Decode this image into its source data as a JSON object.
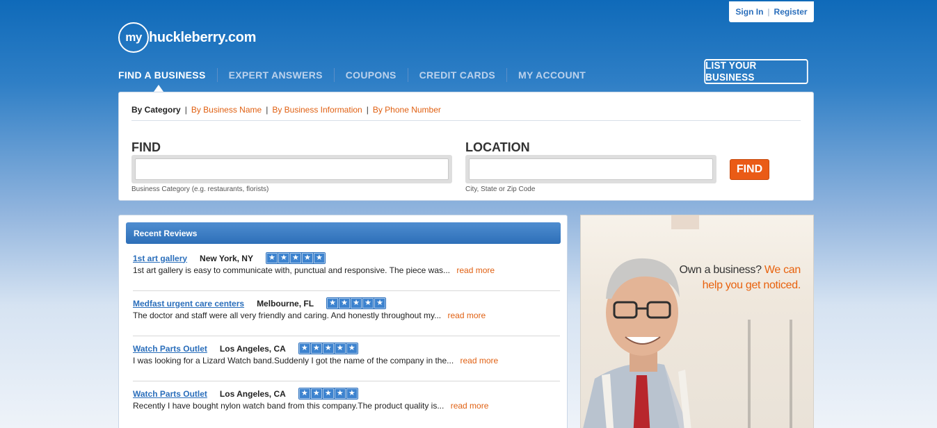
{
  "auth": {
    "signin": "Sign In",
    "separator": "|",
    "register": "Register"
  },
  "logo": {
    "circle": "my",
    "text": "huckleberry.com"
  },
  "nav": {
    "items": [
      "FIND A BUSINESS",
      "EXPERT ANSWERS",
      "COUPONS",
      "CREDIT CARDS",
      "MY ACCOUNT"
    ],
    "active_index": 0
  },
  "list_business": "LIST YOUR BUSINESS",
  "search": {
    "tabs": [
      "By Category",
      "By Business Name",
      "By Business Information",
      "By Phone Number"
    ],
    "tab_separator": "|",
    "find_label": "FIND",
    "find_value": "",
    "find_hint": "Business Category (e.g. restaurants, florists)",
    "location_label": "LOCATION",
    "location_value": "",
    "location_hint": "City, State or Zip Code",
    "button": "FIND"
  },
  "reviews": {
    "title": "Recent Reviews",
    "more_label": "read more",
    "star_glyph": "★",
    "items": [
      {
        "business": "1st art gallery",
        "location": "New York, NY",
        "rating": 5,
        "snippet": "1st art gallery is easy to communicate with, punctual and responsive. The piece was..."
      },
      {
        "business": "Medfast urgent care centers",
        "location": "Melbourne, FL",
        "rating": 5,
        "snippet": "The doctor and staff were all very friendly and caring. And honestly throughout my..."
      },
      {
        "business": "Watch Parts Outlet",
        "location": "Los Angeles, CA",
        "rating": 5,
        "snippet": "I was looking for a Lizard Watch band.Suddenly I got the name of the company in the..."
      },
      {
        "business": "Watch Parts Outlet",
        "location": "Los Angeles, CA",
        "rating": 5,
        "snippet": "Recently I have bought nylon watch band from this company.The product quality is..."
      }
    ]
  },
  "ad": {
    "line1_dark": "Own a business?",
    "line1_orange": "We can",
    "line2": "help you get noticed."
  },
  "colors": {
    "brand_blue": "#2a6ebb",
    "accent_orange": "#ea5b16"
  }
}
